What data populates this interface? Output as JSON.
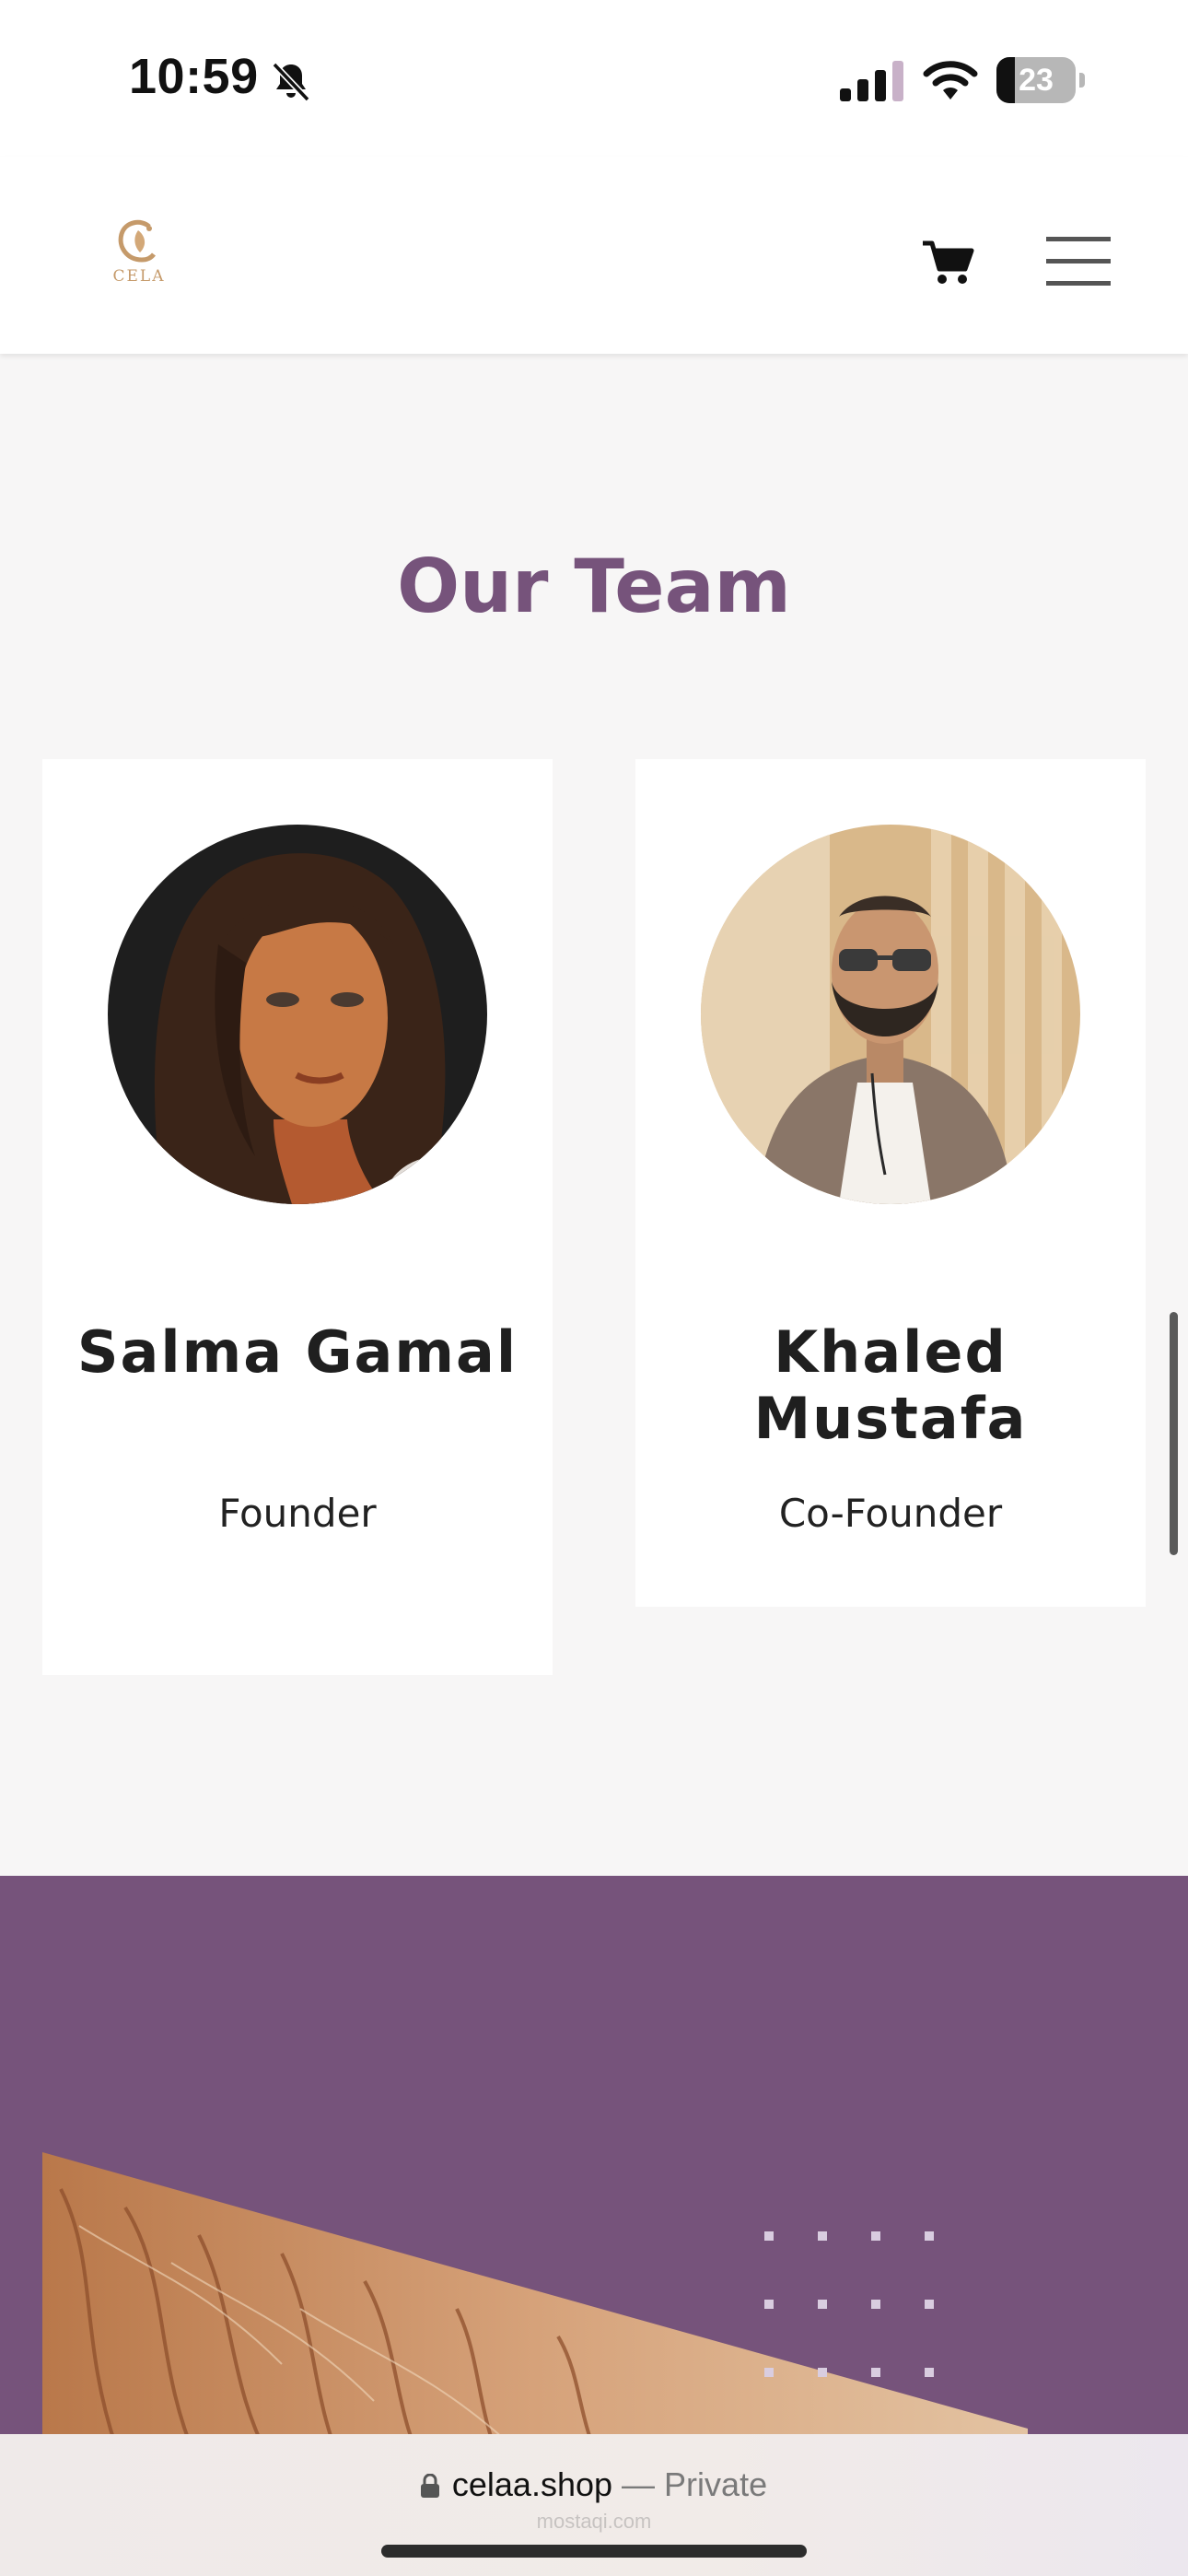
{
  "status_bar": {
    "time": "10:59",
    "battery_level": "23",
    "icons": [
      "bell-slash-icon",
      "cellular-signal-icon",
      "wifi-icon",
      "battery-icon"
    ]
  },
  "header": {
    "logo_text": "CELA",
    "icons": [
      "cart-icon",
      "hamburger-menu-icon"
    ]
  },
  "team": {
    "title": "Our Team",
    "members": [
      {
        "name": "Salma Gamal",
        "role": "Founder"
      },
      {
        "name": "Khaled Mustafa",
        "role": "Co-Founder"
      }
    ]
  },
  "browser": {
    "domain": "celaa.shop",
    "mode": "— Private",
    "watermark": "mostaqi.com"
  },
  "colors": {
    "accent_purple": "#76537b",
    "logo_gold": "#c59a6a",
    "page_background": "#f7f6f6"
  }
}
